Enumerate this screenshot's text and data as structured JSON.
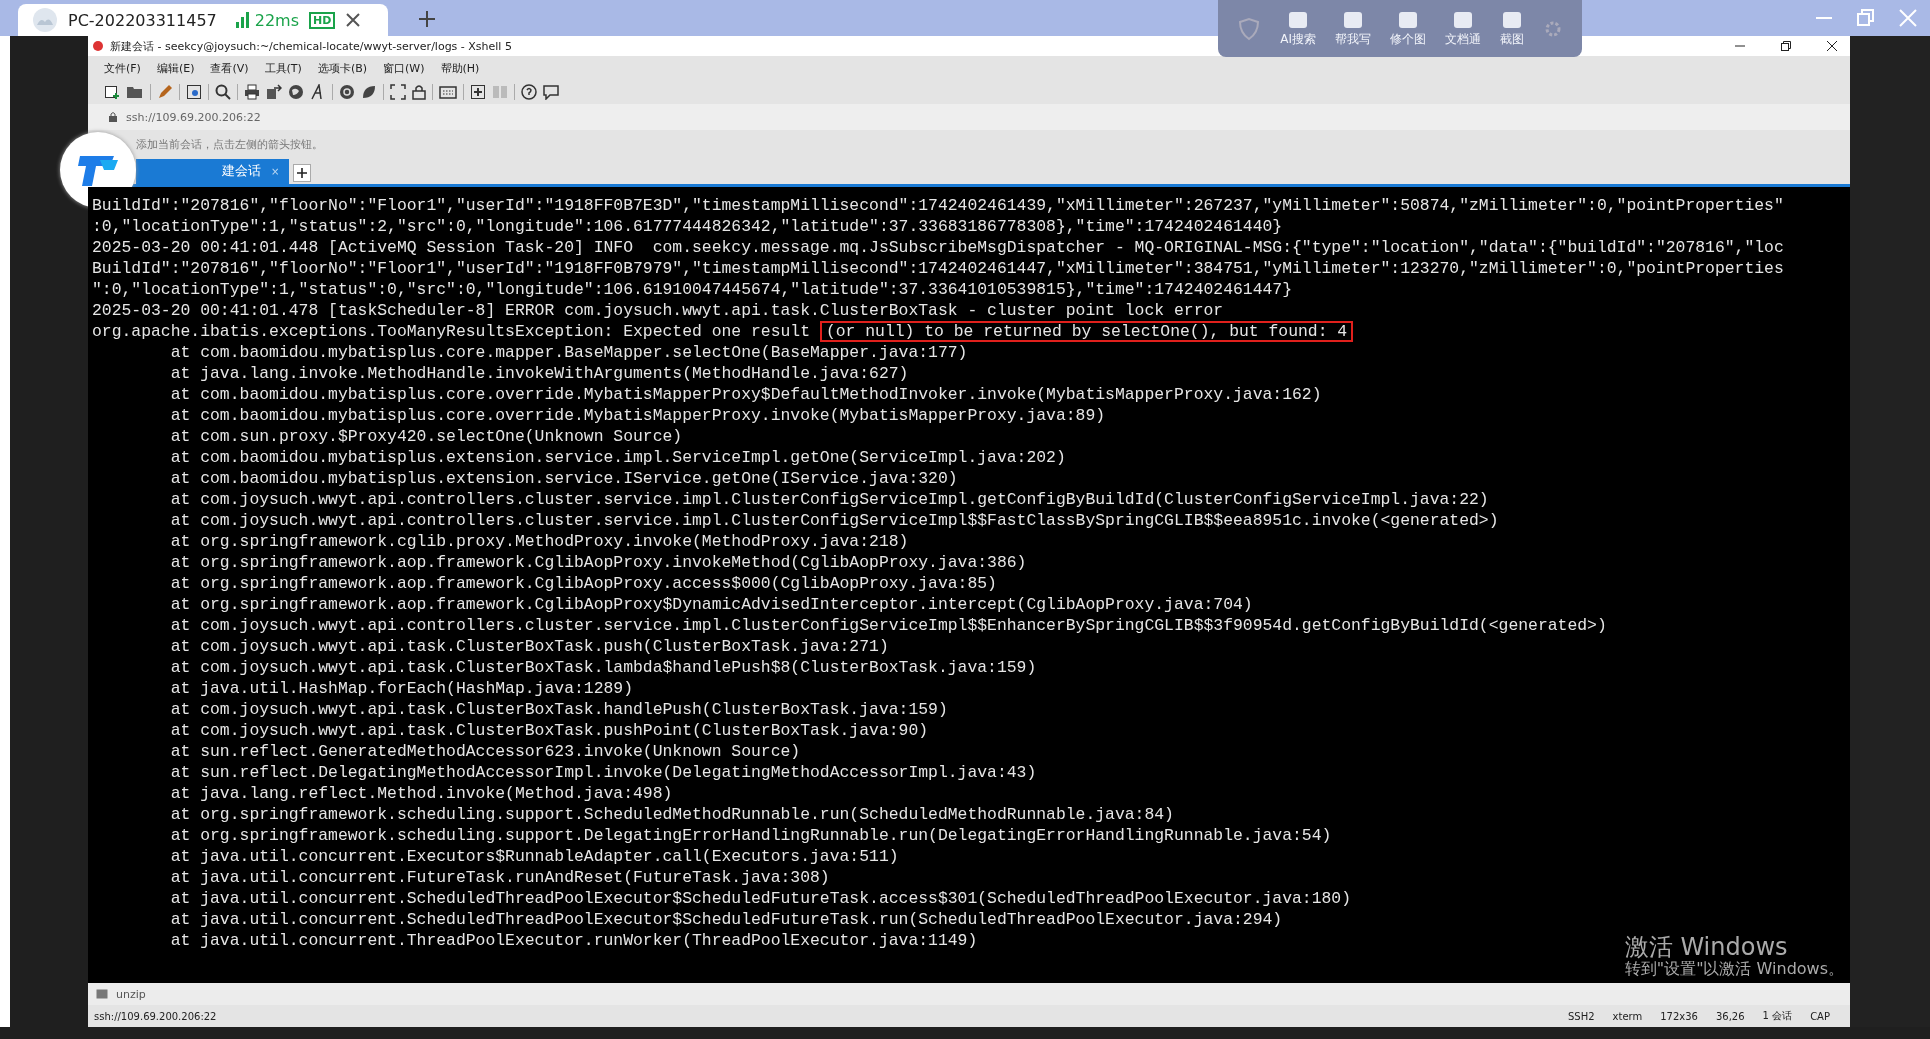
{
  "remote_tab": {
    "title": "PC-202203311457",
    "latency": "22ms",
    "quality": "HD"
  },
  "overlay_toolbar": [
    "AI搜索",
    "帮我写",
    "修个图",
    "文档通",
    "截图"
  ],
  "window": {
    "title": "新建会话 - seekcy@joysuch:~/chemical-locate/wwyt-server/logs - Xshell 5"
  },
  "menu": [
    "文件(F)",
    "编辑(E)",
    "查看(V)",
    "工具(T)",
    "选项卡(B)",
    "窗口(W)",
    "帮助(H)"
  ],
  "address": "ssh://109.69.200.206:22",
  "hint": "添加当前会话，点击左侧的箭头按钮。",
  "tabs": [
    {
      "label": "建会话",
      "close": "×",
      "selected": true
    }
  ],
  "terminal": [
    {
      "text": "BuildId\":\"207816\",\"floorNo\":\"Floor1\",\"userId\":\"1918FF0B7E3D\",\"timestampMillisecond\":1742402461439,\"xMillimeter\":267237,\"yMillimeter\":50874,\"zMillimeter\":0,\"pointProperties\""
    },
    {
      "text": ":0,\"locationType\":1,\"status\":2,\"src\":0,\"longitude\":106.61777444826342,\"latitude\":37.33683186778308},\"time\":1742402461440}"
    },
    {
      "text": "2025-03-20 00:41:01.448 [ActiveMQ Session Task-20] INFO  com.seekcy.message.mq.JsSubscribeMsgDispatcher - MQ-ORIGINAL-MSG:{\"type\":\"location\",\"data\":{\"buildId\":\"207816\",\"loc"
    },
    {
      "text": "BuildId\":\"207816\",\"floorNo\":\"Floor1\",\"userId\":\"1918FF0B7979\",\"timestampMillisecond\":1742402461447,\"xMillimeter\":384751,\"yMillimeter\":123270,\"zMillimeter\":0,\"pointProperties"
    },
    {
      "text": "\":0,\"locationType\":1,\"status\":0,\"src\":0,\"longitude\":106.61910047445674,\"latitude\":37.33641010539815},\"time\":1742402461447}"
    },
    {
      "text": "2025-03-20 00:41:01.478 [taskScheduler-8] ERROR com.joysuch.wwyt.api.task.ClusterBoxTask - cluster point lock error"
    },
    {
      "text": "org.apache.ibatis.exceptions.TooManyResultsException: Expected one result ",
      "highlight": "(or null) to be returned by selectOne(), but found: 4"
    },
    {
      "text": "        at com.baomidou.mybatisplus.core.mapper.BaseMapper.selectOne(BaseMapper.java:177)"
    },
    {
      "text": "        at java.lang.invoke.MethodHandle.invokeWithArguments(MethodHandle.java:627)"
    },
    {
      "text": "        at com.baomidou.mybatisplus.core.override.MybatisMapperProxy$DefaultMethodInvoker.invoke(MybatisMapperProxy.java:162)"
    },
    {
      "text": "        at com.baomidou.mybatisplus.core.override.MybatisMapperProxy.invoke(MybatisMapperProxy.java:89)"
    },
    {
      "text": "        at com.sun.proxy.$Proxy420.selectOne(Unknown Source)"
    },
    {
      "text": "        at com.baomidou.mybatisplus.extension.service.impl.ServiceImpl.getOne(ServiceImpl.java:202)"
    },
    {
      "text": "        at com.baomidou.mybatisplus.extension.service.IService.getOne(IService.java:320)"
    },
    {
      "text": "        at com.joysuch.wwyt.api.controllers.cluster.service.impl.ClusterConfigServiceImpl.getConfigByBuildId(ClusterConfigServiceImpl.java:22)"
    },
    {
      "text": "        at com.joysuch.wwyt.api.controllers.cluster.service.impl.ClusterConfigServiceImpl$$FastClassBySpringCGLIB$$eea8951c.invoke(<generated>)"
    },
    {
      "text": "        at org.springframework.cglib.proxy.MethodProxy.invoke(MethodProxy.java:218)"
    },
    {
      "text": "        at org.springframework.aop.framework.CglibAopProxy.invokeMethod(CglibAopProxy.java:386)"
    },
    {
      "text": "        at org.springframework.aop.framework.CglibAopProxy.access$000(CglibAopProxy.java:85)"
    },
    {
      "text": "        at org.springframework.aop.framework.CglibAopProxy$DynamicAdvisedInterceptor.intercept(CglibAopProxy.java:704)"
    },
    {
      "text": "        at com.joysuch.wwyt.api.controllers.cluster.service.impl.ClusterConfigServiceImpl$$EnhancerBySpringCGLIB$$3f90954d.getConfigByBuildId(<generated>)"
    },
    {
      "text": "        at com.joysuch.wwyt.api.task.ClusterBoxTask.push(ClusterBoxTask.java:271)"
    },
    {
      "text": "        at com.joysuch.wwyt.api.task.ClusterBoxTask.lambda$handlePush$8(ClusterBoxTask.java:159)"
    },
    {
      "text": "        at java.util.HashMap.forEach(HashMap.java:1289)"
    },
    {
      "text": "        at com.joysuch.wwyt.api.task.ClusterBoxTask.handlePush(ClusterBoxTask.java:159)"
    },
    {
      "text": "        at com.joysuch.wwyt.api.task.ClusterBoxTask.pushPoint(ClusterBoxTask.java:90)"
    },
    {
      "text": "        at sun.reflect.GeneratedMethodAccessor623.invoke(Unknown Source)"
    },
    {
      "text": "        at sun.reflect.DelegatingMethodAccessorImpl.invoke(DelegatingMethodAccessorImpl.java:43)"
    },
    {
      "text": "        at java.lang.reflect.Method.invoke(Method.java:498)"
    },
    {
      "text": "        at org.springframework.scheduling.support.ScheduledMethodRunnable.run(ScheduledMethodRunnable.java:84)"
    },
    {
      "text": "        at org.springframework.scheduling.support.DelegatingErrorHandlingRunnable.run(DelegatingErrorHandlingRunnable.java:54)"
    },
    {
      "text": "        at java.util.concurrent.Executors$RunnableAdapter.call(Executors.java:511)"
    },
    {
      "text": "        at java.util.concurrent.FutureTask.runAndReset(FutureTask.java:308)"
    },
    {
      "text": "        at java.util.concurrent.ScheduledThreadPoolExecutor$ScheduledFutureTask.access$301(ScheduledThreadPoolExecutor.java:180)"
    },
    {
      "text": "        at java.util.concurrent.ScheduledThreadPoolExecutor$ScheduledFutureTask.run(ScheduledThreadPoolExecutor.java:294)"
    },
    {
      "text": "        at java.util.concurrent.ThreadPoolExecutor.runWorker(ThreadPoolExecutor.java:1149)"
    }
  ],
  "watermark": {
    "title": "激活 Windows",
    "subtitle": "转到\"设置\"以激活 Windows。"
  },
  "compose_bar": {
    "value": "unzip"
  },
  "status_bar": {
    "address": "ssh://109.69.200.206:22",
    "items": [
      "SSH2",
      "xterm",
      "172x36",
      "36,26",
      "1 会话",
      "CAP"
    ]
  }
}
